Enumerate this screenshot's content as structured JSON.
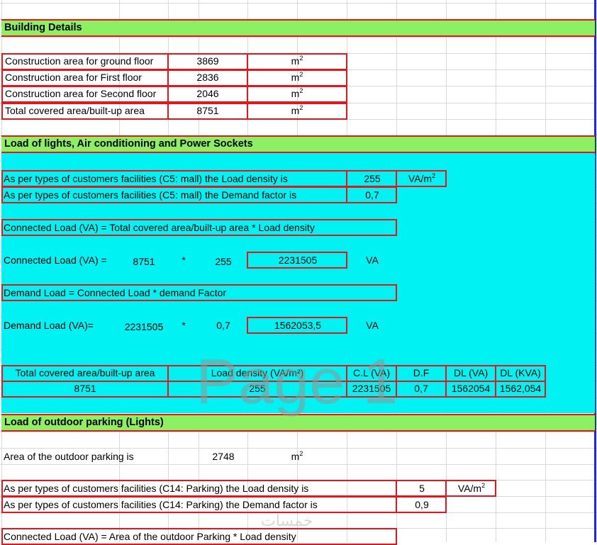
{
  "sections": {
    "building": "Building Details",
    "lights": "Load of lights, Air conditioning and Power Sockets",
    "parking": "Load of outdoor parking (Lights)"
  },
  "building_rows": [
    {
      "label": "Construction area for ground floor",
      "value": "3869",
      "unit": "m",
      "exp": "2"
    },
    {
      "label": "Construction area for First floor",
      "value": "2836",
      "unit": "m",
      "exp": "2"
    },
    {
      "label": "Construction area for Second floor",
      "value": "2046",
      "unit": "m",
      "exp": "2"
    },
    {
      "label": "Total covered area/built-up area",
      "value": "8751",
      "unit": "m",
      "exp": "2"
    }
  ],
  "lights": {
    "density_text": "As per types of customers facilities (C5: mall) the Load density is",
    "density_value": "255",
    "density_unit": "VA/m",
    "density_exp": "2",
    "demand_text": "As per types of customers facilities (C5: mall) the Demand factor is",
    "demand_value": "0,7",
    "connected_formula": "Connected Load (VA) = Total covered area/built-up area * Load density",
    "connected_label": "Connected Load (VA) =",
    "connected_a": "8751",
    "connected_op": "*",
    "connected_b": "255",
    "connected_result": "2231505",
    "connected_unit": "VA",
    "demand_formula": "Demand Load = Connected Load * demand Factor",
    "demandload_label": "Demand Load (VA)=",
    "demandload_a": "2231505",
    "demandload_op": "*",
    "demandload_b": "0,7",
    "demandload_result": "1562053,5",
    "demandload_unit": "VA"
  },
  "summary_table": {
    "headers": [
      "Total covered area/built-up area",
      "Load density (VA/m²)",
      "C.L (VA)",
      "D.F",
      "DL (VA)",
      "DL (KVA)"
    ],
    "row": [
      "8751",
      "255",
      "2231505",
      "0,7",
      "1562054",
      "1562,054"
    ]
  },
  "parking": {
    "area_text": "Area of the outdoor parking is",
    "area_value": "2748",
    "area_unit": "m",
    "area_exp": "2",
    "density_text": "As per types of customers facilities (C14: Parking) the Load density is",
    "density_value": "5",
    "density_unit": "VA/m",
    "density_exp": "2",
    "demand_text": "As per types of customers facilities (C14: Parking) the Demand factor is",
    "demand_value": "0,9",
    "connected_formula": "Connected Load (VA) = Area of the outdoor Parking * Load density"
  },
  "watermark": "Page 1",
  "watermark_ar": "خمسات"
}
